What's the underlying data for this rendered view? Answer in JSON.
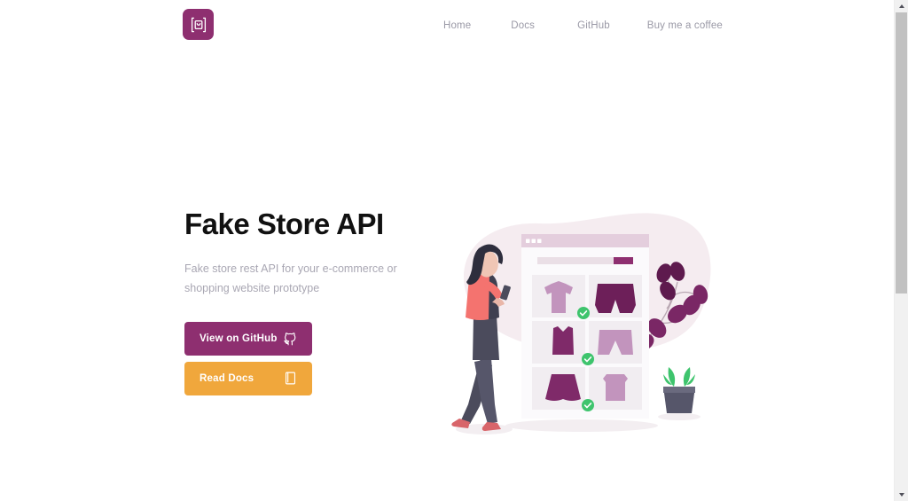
{
  "site": {
    "logo_icon": "shopping-bag-braces-logo",
    "accent_purple": "#8e2f70",
    "accent_orange": "#f0a73c",
    "nav_text_color": "#9a99a6"
  },
  "nav": {
    "items": [
      {
        "label": "Home",
        "name": "nav-link-home"
      },
      {
        "label": "Docs",
        "name": "nav-link-docs"
      },
      {
        "label": "GitHub",
        "name": "nav-link-github"
      },
      {
        "label": "Buy me a coffee",
        "name": "nav-link-buy-me-a-coffee"
      }
    ]
  },
  "hero": {
    "title": "Fake Store API",
    "subtitle": "Fake store rest API for your e-commerce or shopping website prototype",
    "buttons": [
      {
        "label": "View on GitHub",
        "icon": "github-icon",
        "color": "#8e2f70"
      },
      {
        "label": "Read Docs",
        "icon": "book-icon",
        "color": "#f0a73c"
      }
    ],
    "illustration": {
      "name": "online-shopping-illustration",
      "blob_color": "#f5ecf0",
      "elements": [
        "woman-with-phone",
        "browser-window",
        "product-grid",
        "plant-branch",
        "potted-plant"
      ],
      "browser": {
        "dot_count": 3,
        "search_button_color": "#8e2f70"
      },
      "products": [
        {
          "item": "t-shirt",
          "tone": "light",
          "checked": false
        },
        {
          "item": "shorts",
          "tone": "dark",
          "checked": true
        },
        {
          "item": "tank-top",
          "tone": "dark",
          "checked": true
        },
        {
          "item": "shorts",
          "tone": "light",
          "checked": false
        },
        {
          "item": "skirt",
          "tone": "dark",
          "checked": true
        },
        {
          "item": "top",
          "tone": "light",
          "checked": false
        }
      ],
      "check_color": "#3ec46d"
    }
  },
  "scrollbar": {
    "up_arrow": "chevron-up-icon",
    "down_arrow": "chevron-down-icon",
    "thumb": "scrollbar-thumb"
  }
}
